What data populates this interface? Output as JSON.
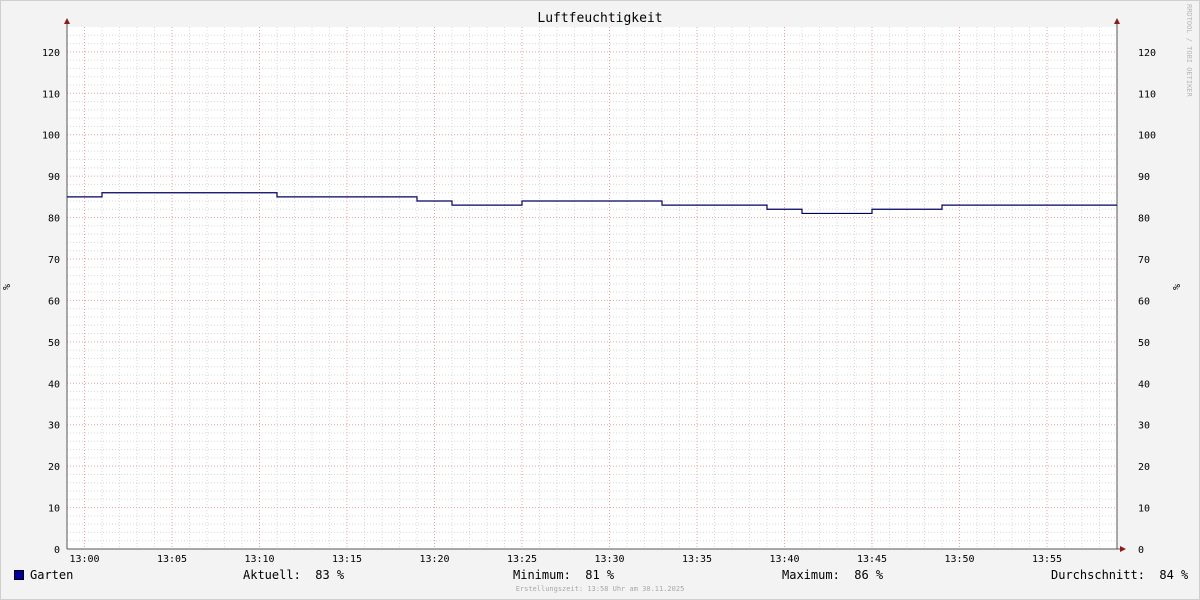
{
  "chart_data": {
    "type": "line",
    "title": "Luftfeuchtigkeit",
    "ylabel": "%",
    "ylabel_right": "%",
    "ylim": [
      0,
      126
    ],
    "y_ticks": [
      0,
      10,
      20,
      30,
      40,
      50,
      60,
      70,
      80,
      90,
      100,
      110,
      120
    ],
    "x_range": [
      "12:59",
      "13:59"
    ],
    "x_ticks": [
      "13:00",
      "13:05",
      "13:10",
      "13:15",
      "13:20",
      "13:25",
      "13:30",
      "13:35",
      "13:40",
      "13:45",
      "13:50",
      "13:55"
    ],
    "grid": true,
    "line_color": "#000060",
    "series": [
      {
        "name": "Garten",
        "step": true,
        "x": [
          "12:59",
          "13:01",
          "13:11",
          "13:19",
          "13:21",
          "13:25",
          "13:33",
          "13:39",
          "13:41",
          "13:45",
          "13:49",
          "13:59"
        ],
        "values": [
          85,
          86,
          85,
          84,
          83,
          84,
          83,
          82,
          81,
          82,
          83,
          83
        ]
      }
    ]
  },
  "legend": {
    "series_name": "Garten",
    "series_color": "#0000a0",
    "aktuell": "Aktuell:  83 %",
    "minimum": "Minimum:  81 %",
    "maximum": "Maximum:  86 %",
    "durchschnitt": "Durchschnitt:  84 %"
  },
  "footer": "Erstellungszeit: 13:58 Uhr am 30.11.2025",
  "watermark": "RRDTOOL / TOBI OETIKER"
}
